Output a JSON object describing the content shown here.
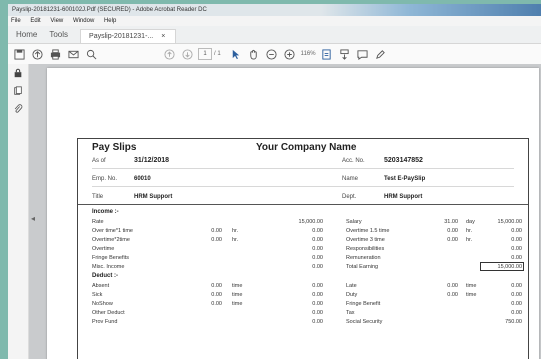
{
  "window": {
    "title": "Payslip-20181231-600102J.Pdf (SECURED) - Adobe Acrobat Reader DC",
    "menu": [
      "File",
      "Edit",
      "View",
      "Window",
      "Help"
    ]
  },
  "tabs": {
    "home": "Home",
    "tools": "Tools",
    "doc": "Payslip-20181231-...",
    "close": "×"
  },
  "toolbar": {
    "page_current": "1",
    "page_total": "/ 1",
    "zoom": "116%"
  },
  "icons": {
    "save": "save-icon",
    "upload": "upload-icon",
    "print": "print-icon",
    "email": "email-icon",
    "search": "search-icon",
    "prev": "page-up-icon",
    "next": "page-down-icon",
    "select": "select-arrow-icon",
    "hand": "hand-icon",
    "zoom_out": "zoom-out-icon",
    "zoom_in": "zoom-in-icon",
    "fit": "fit-page-icon",
    "scroll": "scroll-mode-icon",
    "comment": "comment-icon",
    "sign": "pen-icon",
    "lock": "lock-icon",
    "attach": "attachment-icon"
  },
  "slip": {
    "title": "Pay Slips",
    "company": "Your Company Name",
    "as_of_label": "As of",
    "as_of_value": "31/12/2018",
    "acc_label": "Acc. No.",
    "acc_value": "5203147852",
    "emp_label": "Emp. No.",
    "emp_value": "60010",
    "name_label": "Name",
    "name_value": "Test E-PaySlip",
    "title_label": "Title",
    "title_value": "HRM Support",
    "dept_label": "Dept.",
    "dept_value": "HRM Support",
    "income_header": "Income :-",
    "deduct_header": "Deduct :-",
    "income_rows": [
      {
        "l": "Rate",
        "q": "",
        "u": "",
        "a": "15,000.00",
        "r": "Salary",
        "rq": "31.00",
        "ru": "day",
        "ra": "15,000.00"
      },
      {
        "l": "Over time*1 time",
        "q": "0.00",
        "u": "hr.",
        "a": "0.00",
        "r": "Overtime 1.5 time",
        "rq": "0.00",
        "ru": "hr.",
        "ra": "0.00"
      },
      {
        "l": "Overtime*2time",
        "q": "0.00",
        "u": "hr.",
        "a": "0.00",
        "r": "Overtime 3 time",
        "rq": "0.00",
        "ru": "hr.",
        "ra": "0.00"
      },
      {
        "l": "Overtime",
        "q": "",
        "u": "",
        "a": "0.00",
        "r": "Responsibilities",
        "rq": "",
        "ru": "",
        "ra": "0.00"
      },
      {
        "l": "Fringe Benefits",
        "q": "",
        "u": "",
        "a": "0.00",
        "r": "Remuneration",
        "rq": "",
        "ru": "",
        "ra": "0.00"
      },
      {
        "l": "Misc. Income",
        "q": "",
        "u": "",
        "a": "0.00",
        "r": "Total Earning",
        "rq": "",
        "ru": "",
        "ra": "15,000.00"
      }
    ],
    "deduct_rows": [
      {
        "l": "Absent",
        "q": "0.00",
        "u": "time",
        "a": "0.00",
        "r": "Late",
        "rq": "0.00",
        "ru": "time",
        "ra": "0.00"
      },
      {
        "l": "Sick",
        "q": "0.00",
        "u": "time",
        "a": "0.00",
        "r": "Duty",
        "rq": "0.00",
        "ru": "time",
        "ra": "0.00"
      },
      {
        "l": "NoShow",
        "q": "0.00",
        "u": "time",
        "a": "0.00",
        "r": "Fringe Benefit",
        "rq": "",
        "ru": "",
        "ra": "0.00"
      },
      {
        "l": "Other Deduct",
        "q": "",
        "u": "",
        "a": "0.00",
        "r": "Tax",
        "rq": "",
        "ru": "",
        "ra": "0.00"
      },
      {
        "l": "Prov Fund",
        "q": "",
        "u": "",
        "a": "0.00",
        "r": "Social Security",
        "rq": "",
        "ru": "",
        "ra": "750.00"
      }
    ]
  }
}
